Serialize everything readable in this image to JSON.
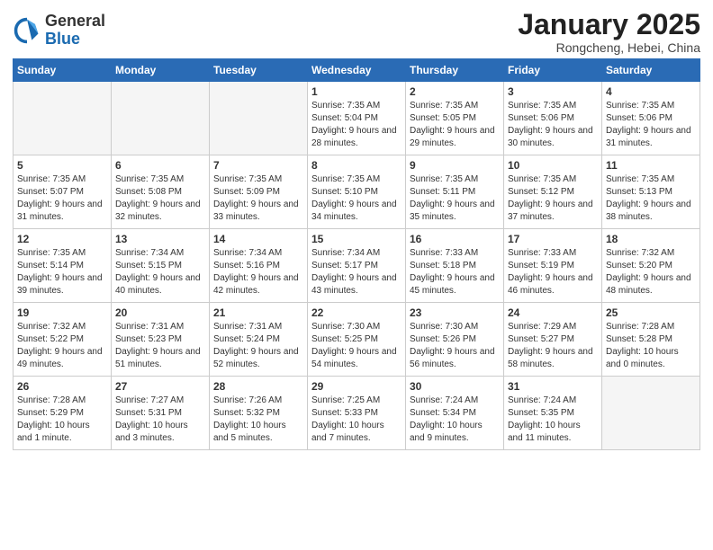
{
  "header": {
    "logo_general": "General",
    "logo_blue": "Blue",
    "month_title": "January 2025",
    "location": "Rongcheng, Hebei, China"
  },
  "weekdays": [
    "Sunday",
    "Monday",
    "Tuesday",
    "Wednesday",
    "Thursday",
    "Friday",
    "Saturday"
  ],
  "weeks": [
    [
      {
        "day": "",
        "empty": true
      },
      {
        "day": "",
        "empty": true
      },
      {
        "day": "",
        "empty": true
      },
      {
        "day": "1",
        "sunrise": "Sunrise: 7:35 AM",
        "sunset": "Sunset: 5:04 PM",
        "daylight": "Daylight: 9 hours and 28 minutes."
      },
      {
        "day": "2",
        "sunrise": "Sunrise: 7:35 AM",
        "sunset": "Sunset: 5:05 PM",
        "daylight": "Daylight: 9 hours and 29 minutes."
      },
      {
        "day": "3",
        "sunrise": "Sunrise: 7:35 AM",
        "sunset": "Sunset: 5:06 PM",
        "daylight": "Daylight: 9 hours and 30 minutes."
      },
      {
        "day": "4",
        "sunrise": "Sunrise: 7:35 AM",
        "sunset": "Sunset: 5:06 PM",
        "daylight": "Daylight: 9 hours and 31 minutes."
      }
    ],
    [
      {
        "day": "5",
        "sunrise": "Sunrise: 7:35 AM",
        "sunset": "Sunset: 5:07 PM",
        "daylight": "Daylight: 9 hours and 31 minutes."
      },
      {
        "day": "6",
        "sunrise": "Sunrise: 7:35 AM",
        "sunset": "Sunset: 5:08 PM",
        "daylight": "Daylight: 9 hours and 32 minutes."
      },
      {
        "day": "7",
        "sunrise": "Sunrise: 7:35 AM",
        "sunset": "Sunset: 5:09 PM",
        "daylight": "Daylight: 9 hours and 33 minutes."
      },
      {
        "day": "8",
        "sunrise": "Sunrise: 7:35 AM",
        "sunset": "Sunset: 5:10 PM",
        "daylight": "Daylight: 9 hours and 34 minutes."
      },
      {
        "day": "9",
        "sunrise": "Sunrise: 7:35 AM",
        "sunset": "Sunset: 5:11 PM",
        "daylight": "Daylight: 9 hours and 35 minutes."
      },
      {
        "day": "10",
        "sunrise": "Sunrise: 7:35 AM",
        "sunset": "Sunset: 5:12 PM",
        "daylight": "Daylight: 9 hours and 37 minutes."
      },
      {
        "day": "11",
        "sunrise": "Sunrise: 7:35 AM",
        "sunset": "Sunset: 5:13 PM",
        "daylight": "Daylight: 9 hours and 38 minutes."
      }
    ],
    [
      {
        "day": "12",
        "sunrise": "Sunrise: 7:35 AM",
        "sunset": "Sunset: 5:14 PM",
        "daylight": "Daylight: 9 hours and 39 minutes."
      },
      {
        "day": "13",
        "sunrise": "Sunrise: 7:34 AM",
        "sunset": "Sunset: 5:15 PM",
        "daylight": "Daylight: 9 hours and 40 minutes."
      },
      {
        "day": "14",
        "sunrise": "Sunrise: 7:34 AM",
        "sunset": "Sunset: 5:16 PM",
        "daylight": "Daylight: 9 hours and 42 minutes."
      },
      {
        "day": "15",
        "sunrise": "Sunrise: 7:34 AM",
        "sunset": "Sunset: 5:17 PM",
        "daylight": "Daylight: 9 hours and 43 minutes."
      },
      {
        "day": "16",
        "sunrise": "Sunrise: 7:33 AM",
        "sunset": "Sunset: 5:18 PM",
        "daylight": "Daylight: 9 hours and 45 minutes."
      },
      {
        "day": "17",
        "sunrise": "Sunrise: 7:33 AM",
        "sunset": "Sunset: 5:19 PM",
        "daylight": "Daylight: 9 hours and 46 minutes."
      },
      {
        "day": "18",
        "sunrise": "Sunrise: 7:32 AM",
        "sunset": "Sunset: 5:20 PM",
        "daylight": "Daylight: 9 hours and 48 minutes."
      }
    ],
    [
      {
        "day": "19",
        "sunrise": "Sunrise: 7:32 AM",
        "sunset": "Sunset: 5:22 PM",
        "daylight": "Daylight: 9 hours and 49 minutes."
      },
      {
        "day": "20",
        "sunrise": "Sunrise: 7:31 AM",
        "sunset": "Sunset: 5:23 PM",
        "daylight": "Daylight: 9 hours and 51 minutes."
      },
      {
        "day": "21",
        "sunrise": "Sunrise: 7:31 AM",
        "sunset": "Sunset: 5:24 PM",
        "daylight": "Daylight: 9 hours and 52 minutes."
      },
      {
        "day": "22",
        "sunrise": "Sunrise: 7:30 AM",
        "sunset": "Sunset: 5:25 PM",
        "daylight": "Daylight: 9 hours and 54 minutes."
      },
      {
        "day": "23",
        "sunrise": "Sunrise: 7:30 AM",
        "sunset": "Sunset: 5:26 PM",
        "daylight": "Daylight: 9 hours and 56 minutes."
      },
      {
        "day": "24",
        "sunrise": "Sunrise: 7:29 AM",
        "sunset": "Sunset: 5:27 PM",
        "daylight": "Daylight: 9 hours and 58 minutes."
      },
      {
        "day": "25",
        "sunrise": "Sunrise: 7:28 AM",
        "sunset": "Sunset: 5:28 PM",
        "daylight": "Daylight: 10 hours and 0 minutes."
      }
    ],
    [
      {
        "day": "26",
        "sunrise": "Sunrise: 7:28 AM",
        "sunset": "Sunset: 5:29 PM",
        "daylight": "Daylight: 10 hours and 1 minute."
      },
      {
        "day": "27",
        "sunrise": "Sunrise: 7:27 AM",
        "sunset": "Sunset: 5:31 PM",
        "daylight": "Daylight: 10 hours and 3 minutes."
      },
      {
        "day": "28",
        "sunrise": "Sunrise: 7:26 AM",
        "sunset": "Sunset: 5:32 PM",
        "daylight": "Daylight: 10 hours and 5 minutes."
      },
      {
        "day": "29",
        "sunrise": "Sunrise: 7:25 AM",
        "sunset": "Sunset: 5:33 PM",
        "daylight": "Daylight: 10 hours and 7 minutes."
      },
      {
        "day": "30",
        "sunrise": "Sunrise: 7:24 AM",
        "sunset": "Sunset: 5:34 PM",
        "daylight": "Daylight: 10 hours and 9 minutes."
      },
      {
        "day": "31",
        "sunrise": "Sunrise: 7:24 AM",
        "sunset": "Sunset: 5:35 PM",
        "daylight": "Daylight: 10 hours and 11 minutes."
      },
      {
        "day": "",
        "empty": true
      }
    ]
  ]
}
